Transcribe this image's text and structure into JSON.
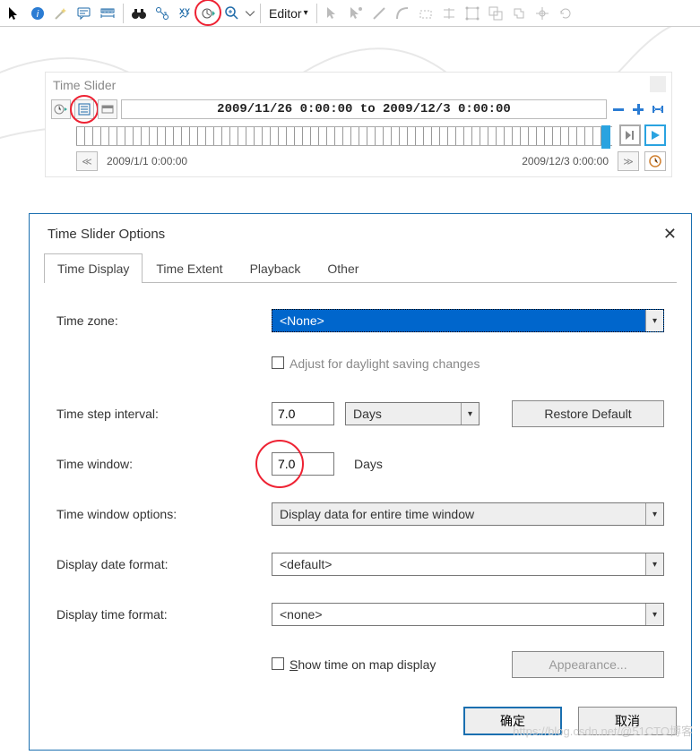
{
  "toolbar": {
    "editor_label": "Editor",
    "icons": [
      "pointer",
      "info",
      "wand",
      "comment",
      "ruler",
      "height-ruler",
      "binoculars",
      "link-arrow",
      "xy",
      "time-slider",
      "zoom-in",
      "separator",
      "editor",
      "separator",
      "edit-pointer",
      "edit-segment",
      "line",
      "arc",
      "poly",
      "trim",
      "extend",
      "cross1",
      "cross2",
      "cross3",
      "center",
      "rotate"
    ]
  },
  "time_slider": {
    "title": "Time Slider",
    "readout": "2009/11/26 0:00:00 to 2009/12/3 0:00:00",
    "start_label": "2009/1/1 0:00:00",
    "end_label": "2009/12/3 0:00:00"
  },
  "dialog": {
    "title": "Time Slider Options",
    "tabs": [
      "Time Display",
      "Time Extent",
      "Playback",
      "Other"
    ],
    "active_tab": 0,
    "labels": {
      "time_zone": "Time zone:",
      "dst": "Adjust for daylight saving changes",
      "time_step": "Time step interval:",
      "time_window": "Time window:",
      "window_opts": "Time window options:",
      "date_fmt": "Display date format:",
      "time_fmt": "Display time format:",
      "show_on_map": "Show time on map display",
      "restore": "Restore Default",
      "appearance": "Appearance...",
      "ok": "确定",
      "cancel": "取消"
    },
    "values": {
      "time_zone": "<None>",
      "dst_checked": false,
      "time_step": "7.0",
      "time_step_unit": "Days",
      "time_window": "7.0",
      "time_window_unit": "Days",
      "window_opts": "Display data for entire time window",
      "date_fmt": "<default>",
      "time_fmt": "<none>",
      "show_on_map_checked": false
    }
  },
  "watermark": "https://blog.csdn.net/@51CTO博客"
}
